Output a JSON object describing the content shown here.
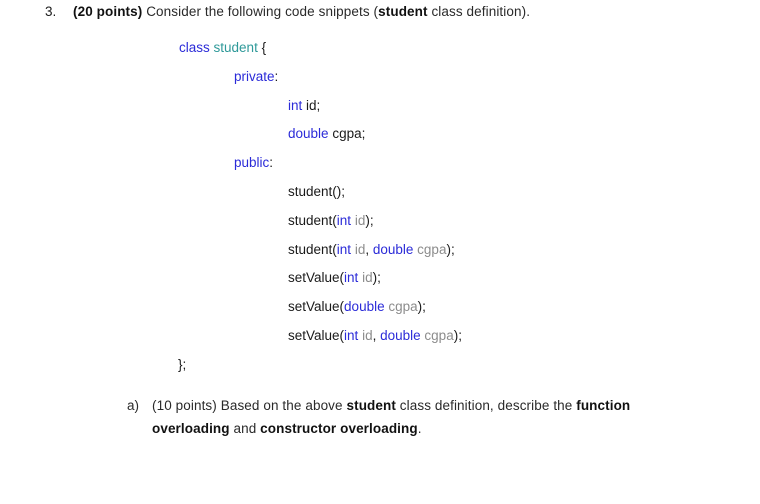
{
  "question": {
    "marker": "3.",
    "points_label": "(20 points)",
    "text_before": " Consider the following code snippets (",
    "emphasis": "student",
    "text_after": " class definition)."
  },
  "code": {
    "lines": [
      {
        "indent": 0,
        "tokens": [
          {
            "kind": "keyword",
            "text": "class"
          },
          {
            "kind": "plain",
            "text": " "
          },
          {
            "kind": "type",
            "text": "student"
          },
          {
            "kind": "plain",
            "text": " {"
          }
        ]
      },
      {
        "indent": 1,
        "tokens": [
          {
            "kind": "keyword",
            "text": "private"
          },
          {
            "kind": "plain",
            "text": ":"
          }
        ]
      },
      {
        "indent": 2,
        "tokens": [
          {
            "kind": "keyword",
            "text": "int"
          },
          {
            "kind": "plain",
            "text": " "
          },
          {
            "kind": "ident",
            "text": "id"
          },
          {
            "kind": "plain",
            "text": ";"
          }
        ]
      },
      {
        "indent": 2,
        "tokens": [
          {
            "kind": "keyword",
            "text": "double"
          },
          {
            "kind": "plain",
            "text": " "
          },
          {
            "kind": "ident",
            "text": "cgpa"
          },
          {
            "kind": "plain",
            "text": ";"
          }
        ]
      },
      {
        "indent": 1,
        "tokens": [
          {
            "kind": "keyword",
            "text": "public"
          },
          {
            "kind": "plain",
            "text": ":"
          }
        ]
      },
      {
        "indent": 2,
        "tokens": [
          {
            "kind": "ident",
            "text": "student"
          },
          {
            "kind": "plain",
            "text": "();"
          }
        ]
      },
      {
        "indent": 2,
        "tokens": [
          {
            "kind": "ident",
            "text": "student"
          },
          {
            "kind": "plain",
            "text": "("
          },
          {
            "kind": "keyword",
            "text": "int"
          },
          {
            "kind": "plain",
            "text": " "
          },
          {
            "kind": "param",
            "text": "id"
          },
          {
            "kind": "plain",
            "text": ");"
          }
        ]
      },
      {
        "indent": 2,
        "tokens": [
          {
            "kind": "ident",
            "text": "student"
          },
          {
            "kind": "plain",
            "text": "("
          },
          {
            "kind": "keyword",
            "text": "int"
          },
          {
            "kind": "plain",
            "text": " "
          },
          {
            "kind": "param",
            "text": "id"
          },
          {
            "kind": "plain",
            "text": ", "
          },
          {
            "kind": "keyword",
            "text": "double"
          },
          {
            "kind": "plain",
            "text": " "
          },
          {
            "kind": "param",
            "text": "cgpa"
          },
          {
            "kind": "plain",
            "text": ");"
          }
        ]
      },
      {
        "indent": 2,
        "tokens": [
          {
            "kind": "ident",
            "text": "setValue"
          },
          {
            "kind": "plain",
            "text": "("
          },
          {
            "kind": "keyword",
            "text": "int"
          },
          {
            "kind": "plain",
            "text": " "
          },
          {
            "kind": "param",
            "text": "id"
          },
          {
            "kind": "plain",
            "text": ");"
          }
        ]
      },
      {
        "indent": 2,
        "tokens": [
          {
            "kind": "ident",
            "text": "setValue"
          },
          {
            "kind": "plain",
            "text": "("
          },
          {
            "kind": "keyword",
            "text": "double"
          },
          {
            "kind": "plain",
            "text": " "
          },
          {
            "kind": "param",
            "text": "cgpa"
          },
          {
            "kind": "plain",
            "text": ");"
          }
        ]
      },
      {
        "indent": 2,
        "tokens": [
          {
            "kind": "ident",
            "text": "setValue"
          },
          {
            "kind": "plain",
            "text": "("
          },
          {
            "kind": "keyword",
            "text": "int"
          },
          {
            "kind": "plain",
            "text": " "
          },
          {
            "kind": "param",
            "text": "id"
          },
          {
            "kind": "plain",
            "text": ", "
          },
          {
            "kind": "keyword",
            "text": "double"
          },
          {
            "kind": "plain",
            "text": " "
          },
          {
            "kind": "param",
            "text": "cgpa"
          },
          {
            "kind": "plain",
            "text": ");"
          }
        ]
      },
      {
        "indent": 3,
        "tokens": [
          {
            "kind": "plain",
            "text": "};"
          }
        ]
      }
    ]
  },
  "subpart": {
    "marker": "a)",
    "segments": [
      {
        "bold": false,
        "text": "(10 points) Based on the above "
      },
      {
        "bold": true,
        "text": "student"
      },
      {
        "bold": false,
        "text": " class definition, describe the "
      },
      {
        "bold": true,
        "text": "function overloading"
      },
      {
        "bold": false,
        "text": " and "
      },
      {
        "bold": true,
        "text": "constructor overloading"
      },
      {
        "bold": false,
        "text": "."
      }
    ]
  },
  "colors": {
    "keyword": "#2b2bd8",
    "type_name": "#2e9999",
    "identifier": "#1a1a1a",
    "parameter": "#8c8c8c",
    "body_text": "#2a2a2a",
    "background": "#ffffff"
  }
}
